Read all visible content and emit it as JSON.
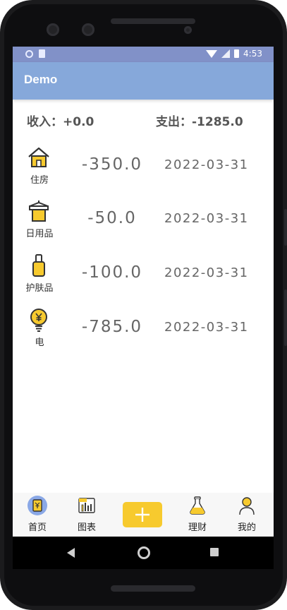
{
  "status_bar": {
    "time": "4:53"
  },
  "app_bar": {
    "title": "Demo"
  },
  "summary": {
    "income": "收入：+0.0",
    "expense": "支出：-1285.0"
  },
  "records": [
    {
      "icon": "house-icon",
      "label": "住房",
      "amount": "-350.0",
      "date": "2022-03-31"
    },
    {
      "icon": "drying-rack-icon",
      "label": "日用品",
      "amount": "-50.0",
      "date": "2022-03-31"
    },
    {
      "icon": "lotion-bottle-icon",
      "label": "护肤品",
      "amount": "-100.0",
      "date": "2022-03-31"
    },
    {
      "icon": "lightbulb-yen-icon",
      "label": "电",
      "amount": "-785.0",
      "date": "2022-03-31"
    }
  ],
  "bottom_nav": {
    "home_label": "首页",
    "chart_label": "图表",
    "finance_label": "理财",
    "mine_label": "我的"
  },
  "colors": {
    "status_bar": "#8191c8",
    "app_bar": "#86a8da",
    "accent": "#f7ca2e",
    "amount_text": "#666666"
  }
}
